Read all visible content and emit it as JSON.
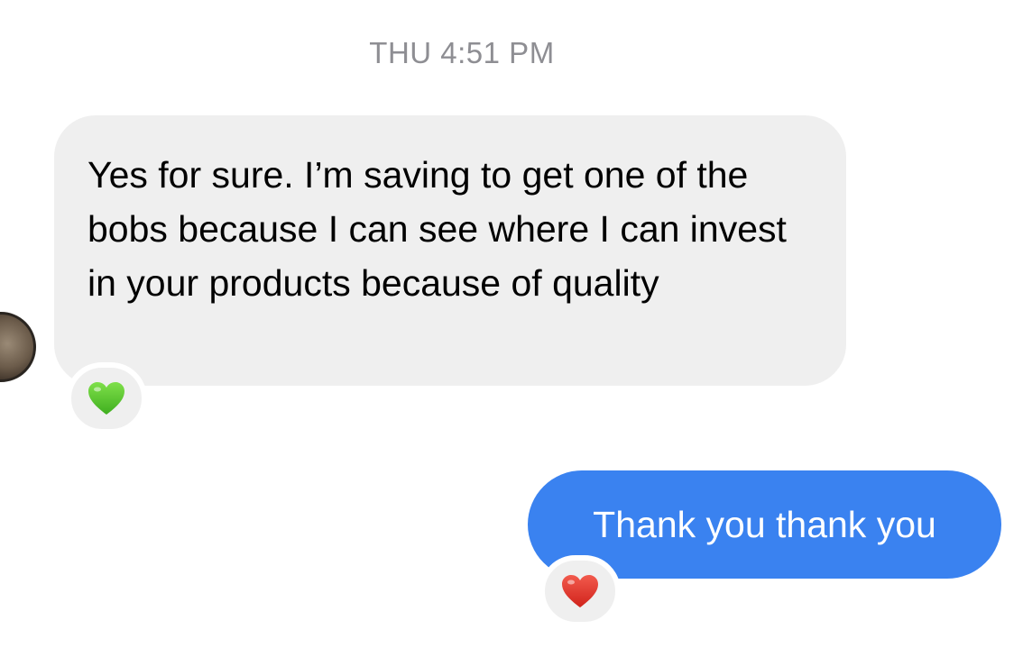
{
  "thread": {
    "timestamp": "THU 4:51 PM"
  },
  "messages": [
    {
      "direction": "incoming",
      "text": "Yes for sure. I’m saving to get one of the bobs because I can see where I can invest in your products because of quality",
      "reaction": "green-heart-icon",
      "bubble_color": "#efefef",
      "reaction_color": "#5fcf2a"
    },
    {
      "direction": "outgoing",
      "text": "Thank you thank you",
      "reaction": "red-heart-icon",
      "bubble_color": "#3a82f0",
      "reaction_color": "#e8352b"
    }
  ]
}
